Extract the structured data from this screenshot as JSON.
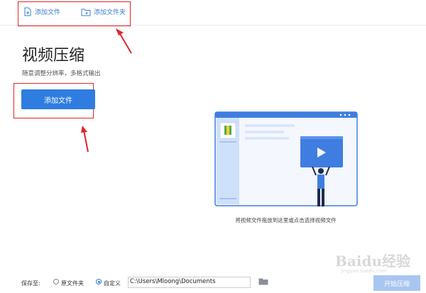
{
  "toolbar": {
    "add_file_label": "添加文件",
    "add_folder_label": "添加文件夹"
  },
  "main": {
    "title": "视频压缩",
    "subtitle": "随意调整分辨率，多格式输出",
    "add_file_button": "添加文件",
    "drop_hint": "将视频文件拖放到这里或点击选择视频文件"
  },
  "save": {
    "label": "保存至:",
    "option_original": "原文件夹",
    "option_custom": "自定义",
    "selected": "自定义",
    "path": "C:\\Users\\Mloong\\Documents",
    "start_button": "开始压缩"
  },
  "watermark": {
    "text": "Baidu经验",
    "url": "jingyan.baidu.com"
  },
  "colors": {
    "accent": "#2f7de1",
    "annotation": "#e0262b",
    "start_disabled": "#a9c6f0"
  }
}
